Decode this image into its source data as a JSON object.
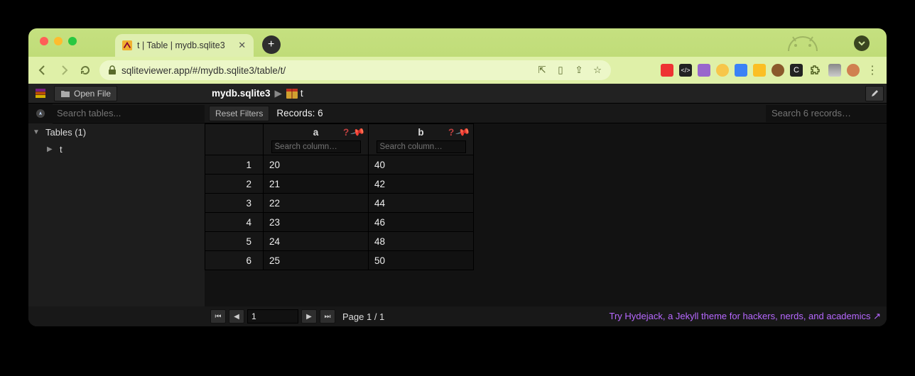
{
  "browser": {
    "tab_title": "t | Table | mydb.sqlite3",
    "url": "sqliteviewer.app/#/mydb.sqlite3/table/t/"
  },
  "toolbar": {
    "open_file": "Open File"
  },
  "breadcrumb": {
    "db": "mydb.sqlite3",
    "table": "t"
  },
  "sidebar": {
    "search_placeholder": "Search tables...",
    "tables_heading": "Tables (1)",
    "items": [
      "t"
    ]
  },
  "filters": {
    "reset": "Reset Filters",
    "records": "Records: 6",
    "search_placeholder": "Search 6 records…"
  },
  "columns": [
    {
      "name": "a",
      "filter_placeholder": "Search column…"
    },
    {
      "name": "b",
      "filter_placeholder": "Search column…"
    }
  ],
  "rows": [
    {
      "n": "1",
      "a": "20",
      "b": "40"
    },
    {
      "n": "2",
      "a": "21",
      "b": "42"
    },
    {
      "n": "3",
      "a": "22",
      "b": "44"
    },
    {
      "n": "4",
      "a": "23",
      "b": "46"
    },
    {
      "n": "5",
      "a": "24",
      "b": "48"
    },
    {
      "n": "6",
      "a": "25",
      "b": "50"
    }
  ],
  "pager": {
    "current": "1",
    "text": "Page 1 / 1"
  },
  "promo": "Try Hydejack, a Jekyll theme for hackers, nerds, and academics ↗"
}
